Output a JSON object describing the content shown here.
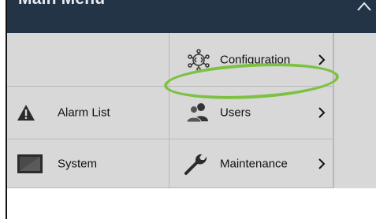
{
  "header": {
    "title": "Main Menu",
    "collapse_icon": "chevron-up-icon"
  },
  "menu": {
    "configuration": {
      "label": "Configuration",
      "icon": "gear-network-icon"
    },
    "alarm_list": {
      "label": "Alarm List",
      "icon": "warning-triangle-icon"
    },
    "users": {
      "label": "Users",
      "icon": "users-icon"
    },
    "system": {
      "label": "System",
      "icon": "monitor-icon"
    },
    "maintenance": {
      "label": "Maintenance",
      "icon": "wrench-icon"
    }
  },
  "annotation": {
    "color": "#7cc142"
  },
  "colors": {
    "header_bg": "#233447",
    "tile_bg": "#d8d8d8"
  }
}
